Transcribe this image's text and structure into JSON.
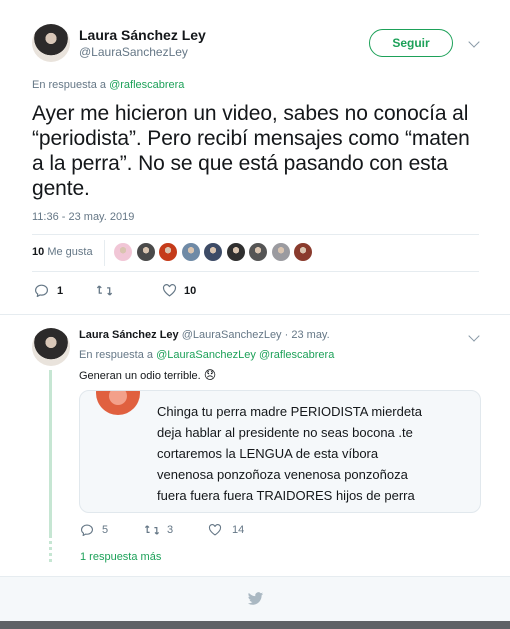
{
  "main_tweet": {
    "author_name": "Laura Sánchez Ley",
    "author_handle": "@LauraSanchezLey",
    "follow_label": "Seguir",
    "reply_prefix": "En respuesta a",
    "reply_to": "@raflescabrera",
    "text": "Ayer me hicieron un video, sabes no conocía al “periodista”. Pero recibí mensajes como “maten a la perra”. No se que está pasando con esta gente.",
    "timestamp": "11:36 - 23 may. 2019",
    "likes_count": "10",
    "likes_label": "Me gusta",
    "likers": [
      "#f1c6d6",
      "#4a4a4a",
      "#c53b1a",
      "#6f8aa6",
      "#3d4b66",
      "#2f2f2f",
      "#555555",
      "#9b9ba0",
      "#8a3b2d"
    ],
    "actions": {
      "replies": "1",
      "retweets": "",
      "likes": "10"
    }
  },
  "reply_tweet": {
    "author_name": "Laura Sánchez Ley",
    "author_handle": "@LauraSanchezLey",
    "separator": "·",
    "date": "23 may.",
    "reply_prefix": "En respuesta a",
    "reply_to_1": "@LauraSanchezLey",
    "reply_to_2": "@raflescabrera",
    "text": "Generan un odio terrible.",
    "emoji": "😞",
    "quote_lines": [
      "Chinga tu perra madre PERIODISTA mierdeta",
      "deja hablar al presidente no seas bocona .te",
      "cortaremos la LENGUA de esta víbora",
      "venenosa ponzoñoza venenosa ponzoñoza",
      "fuera fuera fuera TRAIDORES hijos de perra"
    ],
    "actions": {
      "replies": "5",
      "retweets": "3",
      "likes": "14"
    },
    "more_replies": "1 respuesta más"
  },
  "colors": {
    "accent": "#1da159",
    "muted": "#657786",
    "divider": "#e6ecf0",
    "quote_avatar": "#e0603f"
  }
}
